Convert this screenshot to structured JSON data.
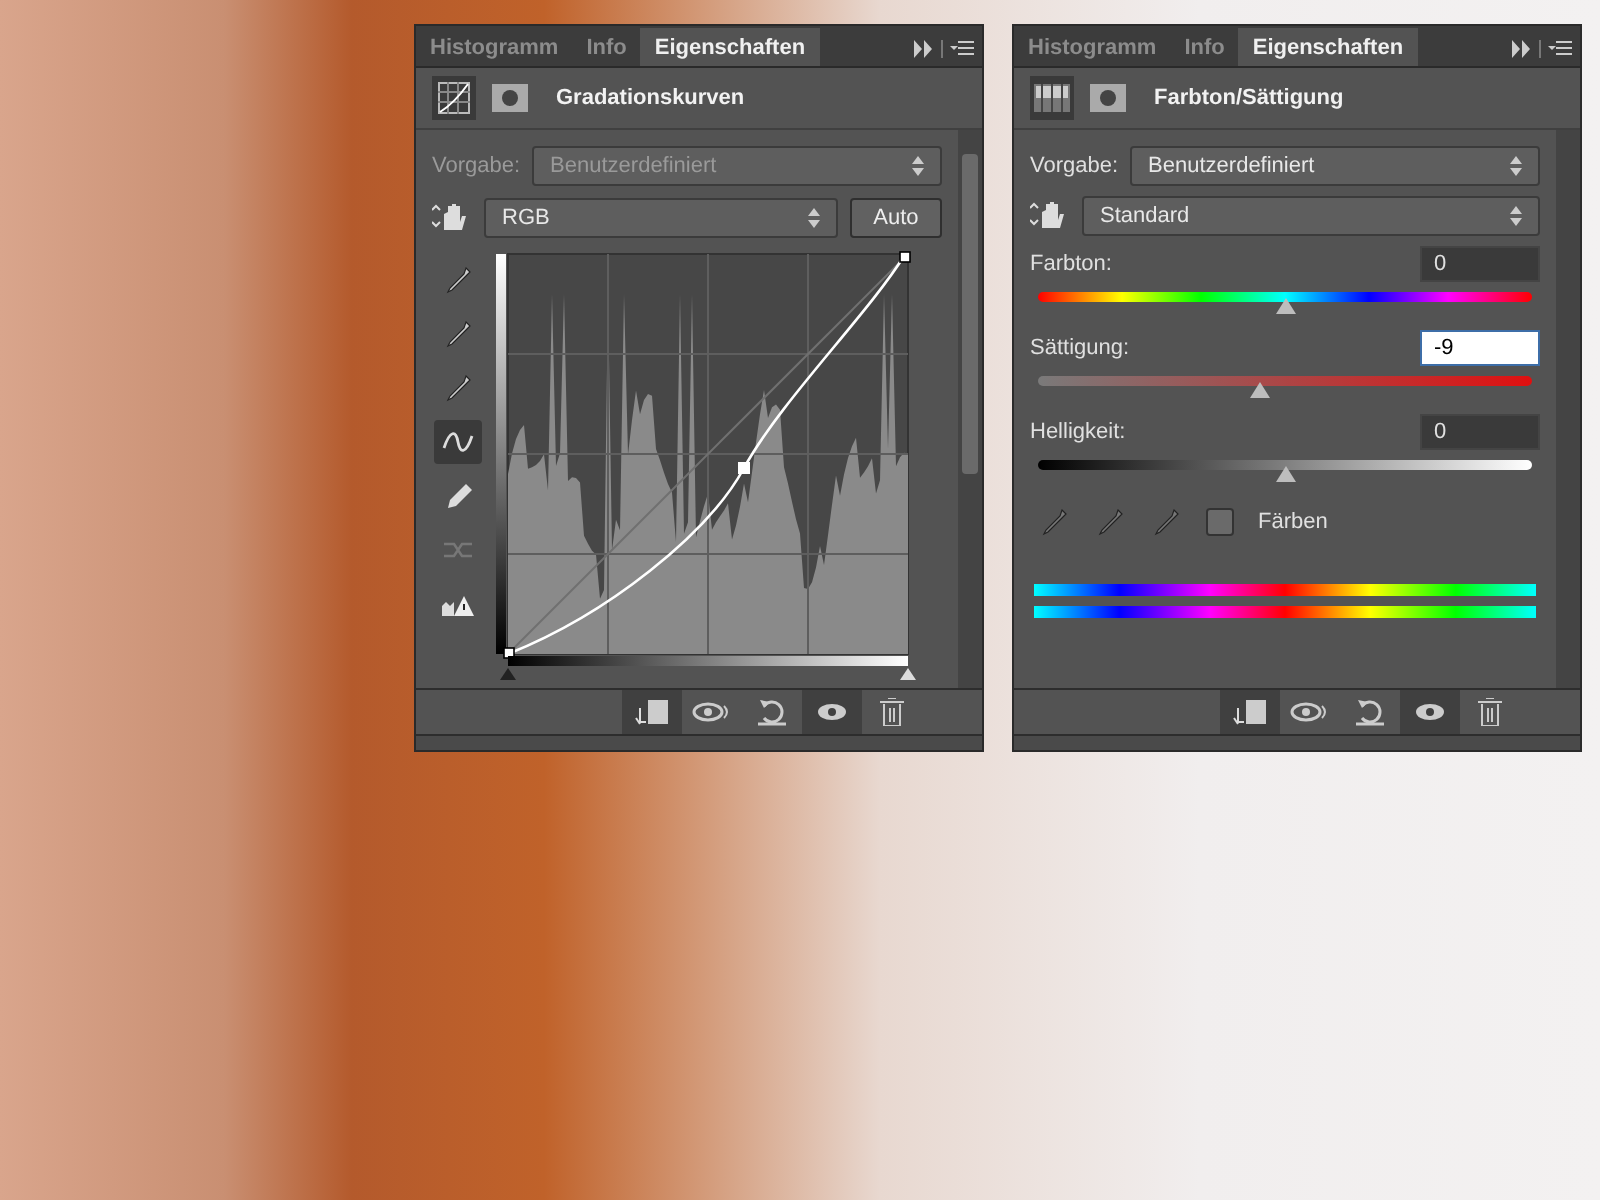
{
  "panels": [
    {
      "kind": "curves",
      "tabs": [
        {
          "label": "Histogramm",
          "selected": false
        },
        {
          "label": "Info",
          "selected": false
        },
        {
          "label": "Eigenschaften",
          "selected": true
        }
      ],
      "title": "Gradationskurven",
      "preset_label": "Vorgabe:",
      "preset": "Benutzerdefiniert",
      "preset_disabled": true,
      "channel": "RGB",
      "auto_button": "Auto",
      "tools": [
        {
          "kind": "dropper",
          "selected": false
        },
        {
          "kind": "dropper",
          "selected": false
        },
        {
          "kind": "dropper",
          "selected": false
        },
        {
          "kind": "curve",
          "selected": true
        },
        {
          "kind": "pencil",
          "selected": false
        },
        {
          "kind": "smooth",
          "selected": false
        },
        {
          "kind": "warning",
          "selected": false
        }
      ]
    },
    {
      "kind": "hue_saturation",
      "tabs": [
        {
          "label": "Histogramm",
          "selected": false
        },
        {
          "label": "Info",
          "selected": false
        },
        {
          "label": "Eigenschaften",
          "selected": true
        }
      ],
      "title": "Farbton/Sättigung",
      "preset_label": "Vorgabe:",
      "preset": "Benutzerdefiniert",
      "preset_disabled": false,
      "range": "Standard",
      "sliders": [
        {
          "kind": "hue",
          "label": "Farbton:",
          "value": "0",
          "focused": false,
          "level": 0.5
        },
        {
          "kind": "saturation",
          "label": "Sättigung:",
          "value": "-9",
          "focused": true,
          "level": 0.45
        },
        {
          "kind": "lightness",
          "label": "Helligkeit:",
          "value": "0",
          "focused": false,
          "level": 0.5
        }
      ],
      "colorize": {
        "label": "Färben",
        "checked": false
      }
    }
  ]
}
